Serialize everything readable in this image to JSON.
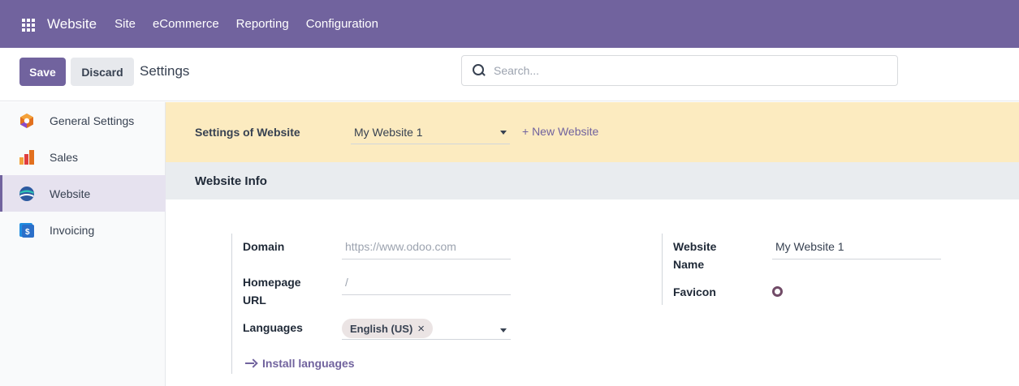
{
  "navbar": {
    "brand": "Website",
    "menu": [
      "Site",
      "eCommerce",
      "Reporting",
      "Configuration"
    ]
  },
  "control_panel": {
    "save_label": "Save",
    "discard_label": "Discard",
    "breadcrumb": "Settings",
    "search_placeholder": "Search..."
  },
  "sidebar": {
    "items": [
      {
        "label": "General Settings",
        "icon": "general-settings-icon"
      },
      {
        "label": "Sales",
        "icon": "sales-icon"
      },
      {
        "label": "Website",
        "icon": "website-icon",
        "active": true
      },
      {
        "label": "Invoicing",
        "icon": "invoicing-icon"
      }
    ]
  },
  "banner": {
    "label": "Settings of Website",
    "selected_website": "My Website 1",
    "new_website_label": "+ New Website"
  },
  "section": {
    "title": "Website Info"
  },
  "fields": {
    "domain_label": "Domain",
    "domain_placeholder": "https://www.odoo.com",
    "homepage_label_line1": "Homepage",
    "homepage_label_line2": "URL",
    "homepage_placeholder": "/",
    "languages_label": "Languages",
    "language_tag": "English (US)",
    "language_tag_close": "×",
    "install_languages_label": "Install languages",
    "website_name_label_line1": "Website",
    "website_name_label_line2": "Name",
    "website_name_value": "My Website 1",
    "favicon_label": "Favicon"
  },
  "colors": {
    "brand": "#71639e",
    "banner_bg": "#fcebc0",
    "section_bg": "#e9ecef"
  }
}
